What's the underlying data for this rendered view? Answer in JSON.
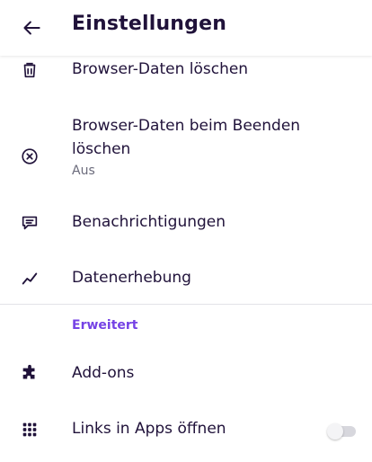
{
  "header": {
    "title": "Einstellungen",
    "back_icon": "arrow-left-icon"
  },
  "items": [
    {
      "label": "Browser-Daten löschen",
      "icon": "trash-icon"
    },
    {
      "label_line1": "Browser-Daten beim Beenden",
      "label_line2": "löschen",
      "sub": "Aus",
      "icon": "close-circle-icon"
    },
    {
      "label": "Benachrichtigungen",
      "icon": "chat-bubble-icon"
    },
    {
      "label": "Datenerhebung",
      "icon": "chart-line-icon"
    }
  ],
  "section": {
    "title": "Erweitert"
  },
  "advanced_items": [
    {
      "label": "Add-ons",
      "icon": "puzzle-icon"
    },
    {
      "label": "Links in Apps öffnen",
      "icon": "grid-icon",
      "toggle_on": false
    }
  ],
  "colors": {
    "accent": "#7542e5",
    "text": "#20123a",
    "subtext": "#6b6b7b"
  }
}
